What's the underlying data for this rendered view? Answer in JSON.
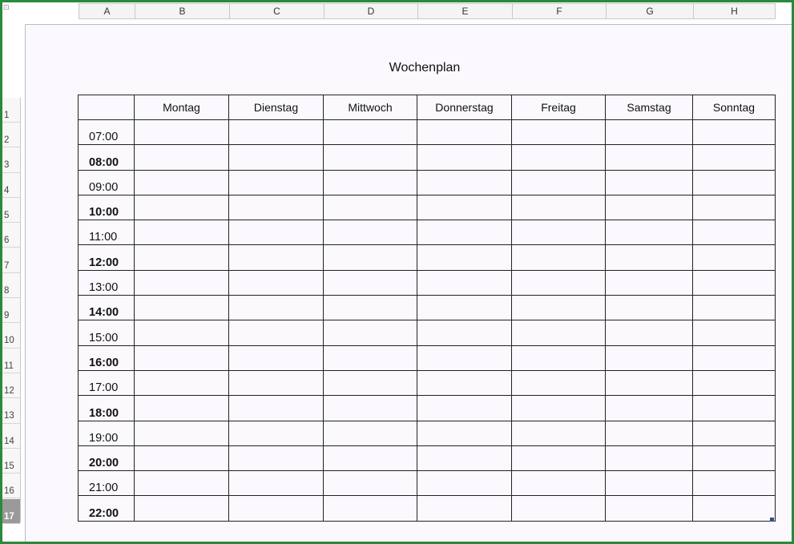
{
  "column_headers": [
    "A",
    "B",
    "C",
    "D",
    "E",
    "F",
    "G",
    "H"
  ],
  "row_numbers": [
    "1",
    "2",
    "3",
    "4",
    "5",
    "6",
    "7",
    "8",
    "9",
    "10",
    "11",
    "12",
    "13",
    "14",
    "15",
    "16",
    "17"
  ],
  "active_row": "17",
  "sheet": {
    "title": "Wochenplan",
    "days": [
      "Montag",
      "Dienstag",
      "Mittwoch",
      "Donnerstag",
      "Freitag",
      "Samstag",
      "Sonntag"
    ],
    "times": [
      "07:00",
      "08:00",
      "09:00",
      "10:00",
      "11:00",
      "12:00",
      "13:00",
      "14:00",
      "15:00",
      "16:00",
      "17:00",
      "18:00",
      "19:00",
      "20:00",
      "21:00",
      "22:00"
    ]
  },
  "colors": {
    "frame": "#2a8a3a",
    "page_background": "#fbf9fd",
    "active_row_header": "#9a9a9a"
  }
}
